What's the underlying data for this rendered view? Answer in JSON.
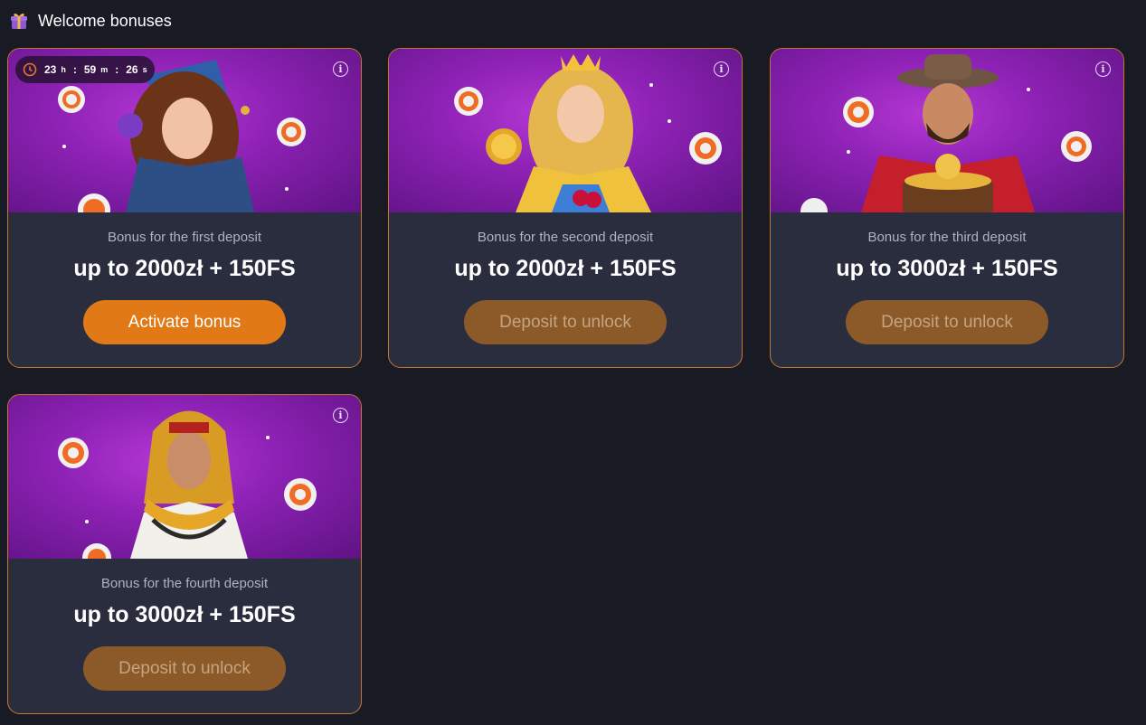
{
  "header": {
    "title": "Welcome bonuses",
    "icon": "gift-icon"
  },
  "timer": {
    "hours": "23",
    "hours_unit": "h",
    "minutes": "59",
    "minutes_unit": "m",
    "seconds": "26",
    "seconds_unit": "s"
  },
  "colors": {
    "background": "#181a24",
    "card": "#292d3e",
    "border": "#c8762b",
    "active_button": "#e17a16",
    "locked_button": "#8c5a28",
    "hero_purple": "#8e22b5"
  },
  "bonuses": [
    {
      "subtitle": "Bonus for the first deposit",
      "amount": "up to 2000zł + 150FS",
      "button": "Activate bonus",
      "state": "active",
      "image": "jester-woman"
    },
    {
      "subtitle": "Bonus for the second deposit",
      "amount": "up to 2000zł + 150FS",
      "button": "Deposit to unlock",
      "state": "locked",
      "image": "queen-with-coin"
    },
    {
      "subtitle": "Bonus for the third deposit",
      "amount": "up to 3000zł + 150FS",
      "button": "Deposit to unlock",
      "state": "locked",
      "image": "cowboy-with-treasure"
    },
    {
      "subtitle": "Bonus for the fourth deposit",
      "amount": "up to 3000zł + 150FS",
      "button": "Deposit to unlock",
      "state": "locked",
      "image": "egyptian-queen"
    }
  ]
}
